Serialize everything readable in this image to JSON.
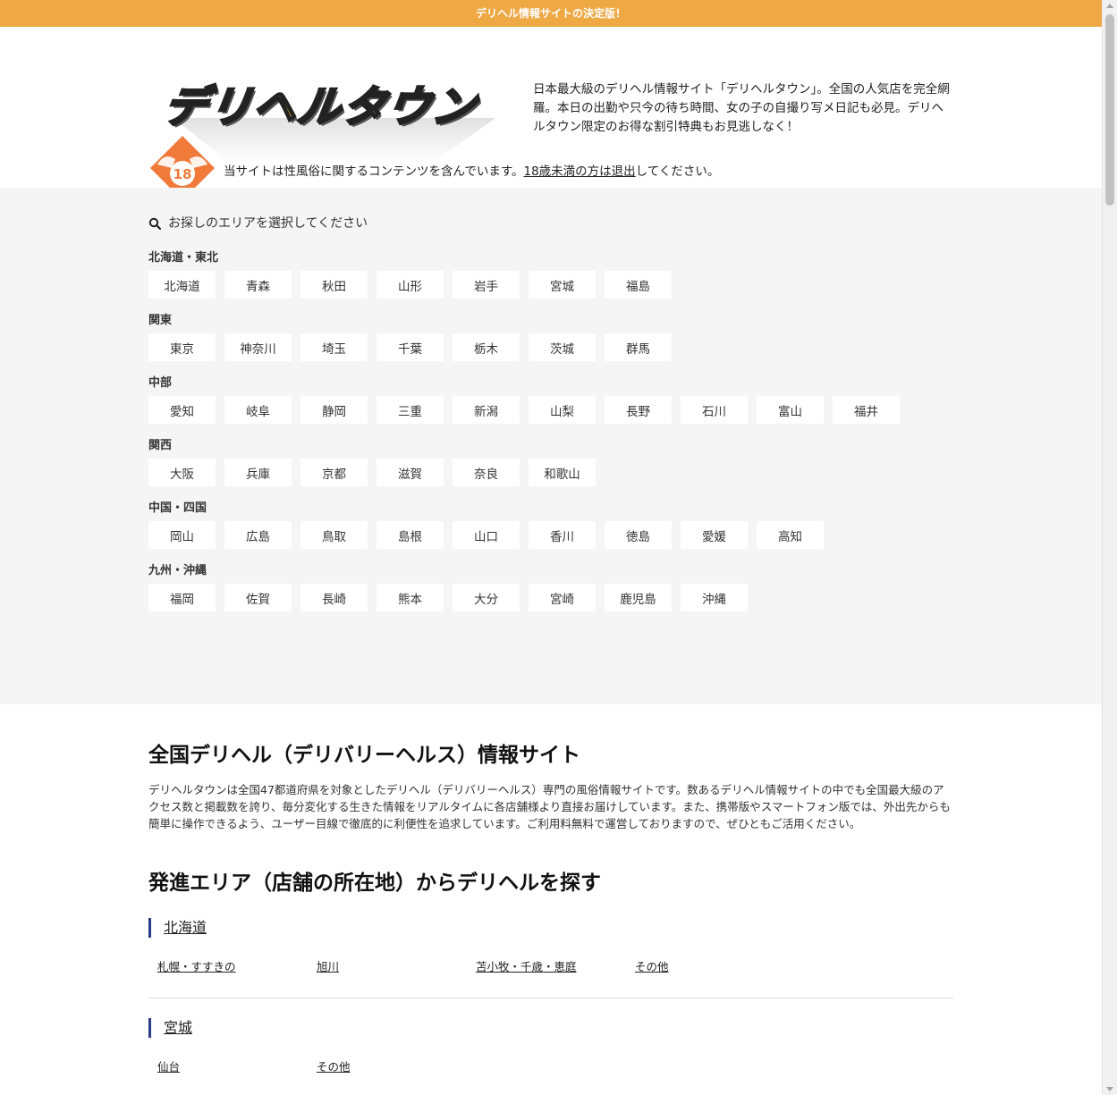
{
  "topbar": {
    "text": "デリヘル情報サイトの決定版！"
  },
  "header": {
    "logo_text": "デリヘルタウン",
    "description": "日本最大級のデリヘル情報サイト「デリヘルタウン」。全国の人気店を完全網羅。本日の出勤や只今の待ち時間、女の子の自撮り写メ日記も必見。デリヘルタウン限定のお得な割引特典もお見逃しなく！",
    "badge_number": "18",
    "age_notice_pre": "当サイトは性風俗に関するコンテンツを含んでいます。",
    "age_notice_link": "18歳未満の方は退出",
    "age_notice_post": "してください。"
  },
  "area_search": {
    "hint": "お探しのエリアを選択してください",
    "regions": [
      {
        "name": "北海道・東北",
        "prefs": [
          "北海道",
          "青森",
          "秋田",
          "山形",
          "岩手",
          "宮城",
          "福島"
        ]
      },
      {
        "name": "関東",
        "prefs": [
          "東京",
          "神奈川",
          "埼玉",
          "千葉",
          "栃木",
          "茨城",
          "群馬"
        ]
      },
      {
        "name": "中部",
        "prefs": [
          "愛知",
          "岐阜",
          "静岡",
          "三重",
          "新潟",
          "山梨",
          "長野",
          "石川",
          "富山",
          "福井"
        ]
      },
      {
        "name": "関西",
        "prefs": [
          "大阪",
          "兵庫",
          "京都",
          "滋賀",
          "奈良",
          "和歌山"
        ]
      },
      {
        "name": "中国・四国",
        "prefs": [
          "岡山",
          "広島",
          "鳥取",
          "島根",
          "山口",
          "香川",
          "徳島",
          "愛媛",
          "高知"
        ]
      },
      {
        "name": "九州・沖縄",
        "prefs": [
          "福岡",
          "佐賀",
          "長崎",
          "熊本",
          "大分",
          "宮崎",
          "鹿児島",
          "沖縄"
        ]
      }
    ]
  },
  "main": {
    "heading": "全国デリヘル（デリバリーヘルス）情報サイト",
    "intro": "デリヘルタウンは全国47都道府県を対象としたデリヘル（デリバリーヘルス）専門の風俗情報サイトです。数あるデリヘル情報サイトの中でも全国最大級のアクセス数と掲載数を誇り、毎分変化する生きた情報をリアルタイムに各店舗様より直接お届けしています。また、携帯版やスマートフォン版では、外出先からも簡単に操作できるよう、ユーザー目線で徹底的に利便性を追求しています。ご利用料無料で運営しておりますので、ぜひともご活用ください。",
    "area_heading": "発進エリア（店舗の所在地）からデリヘルを探す",
    "pref_blocks": [
      {
        "title": "北海道",
        "cities": [
          "札幌・すすきの",
          "旭川",
          "苫小牧・千歳・恵庭",
          "その他"
        ]
      },
      {
        "title": "宮城",
        "cities": [
          "仙台",
          "その他"
        ]
      }
    ]
  },
  "colors": {
    "topbar": "#eea945",
    "panel": "#f5f5f5",
    "accent_bar": "#2a3a8a",
    "badge": "#f07a3a"
  }
}
